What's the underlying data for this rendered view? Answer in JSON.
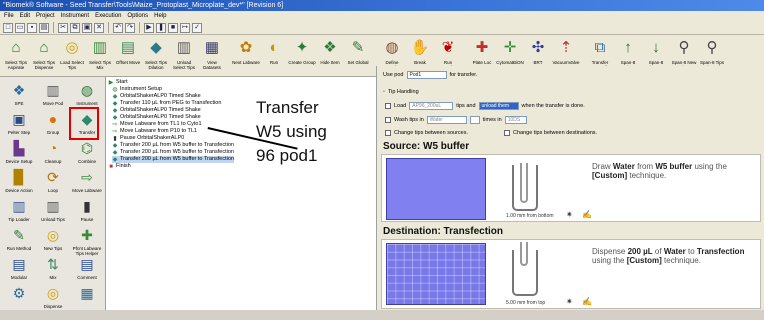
{
  "titlebar": "\"Biomek® Software - Seed Transfer\\Tools\\Maize_Protoplast_Microplate_dev*\" [Revision 6]",
  "menu": [
    "File",
    "Edit",
    "Project",
    "Instrument",
    "Execution",
    "Options",
    "Help"
  ],
  "toolbar": [
    {
      "label": "Select Tips Aspirate",
      "icon": "tip-aspirate-icon",
      "glyph": "⌂",
      "color": "#2a7a3a"
    },
    {
      "label": "Select Tips Dispense",
      "icon": "tip-dispense-icon",
      "glyph": "⌂",
      "color": "#2a7a3a"
    },
    {
      "label": "Load Select Tips",
      "icon": "load-tips-icon",
      "glyph": "◎",
      "color": "#d0a000"
    },
    {
      "label": "Select Tips Mix",
      "icon": "mix-icon",
      "glyph": "▥",
      "color": "#3a8a3a"
    },
    {
      "label": "Offset Move",
      "icon": "offset-move-icon",
      "glyph": "▤",
      "color": "#3a8a5a"
    },
    {
      "label": "Select Tips Dilution",
      "icon": "dilution-icon",
      "glyph": "◆",
      "color": "#2a7a8a"
    },
    {
      "label": "Unload Select Tips",
      "icon": "unload-tips-icon",
      "glyph": "▥",
      "color": "#5a5a5a"
    },
    {
      "label": "View Datasets",
      "icon": "datasets-icon",
      "glyph": "▦",
      "color": "#3a3a6a"
    },
    {
      "label": "Next Labware",
      "icon": "next-labware-icon",
      "glyph": "✿",
      "color": "#c08000"
    },
    {
      "label": "Run",
      "icon": "run-icon",
      "glyph": "◐",
      "color": "#b0a000"
    },
    {
      "label": "Create Group",
      "icon": "create-group-icon",
      "glyph": "✦",
      "color": "#2a7a3a"
    },
    {
      "label": "Hide Item",
      "icon": "hide-item-icon",
      "glyph": "❖",
      "color": "#2a7a3a"
    },
    {
      "label": "Set Global",
      "icon": "set-global-icon",
      "glyph": "✎",
      "color": "#2a7a3a"
    },
    {
      "label": "Define Procedure",
      "icon": "define-procedure-icon",
      "glyph": "◍",
      "color": "#8a4a2a"
    },
    {
      "label": "Break",
      "icon": "break-icon",
      "glyph": "✋",
      "color": "#c03000"
    },
    {
      "label": "Run Procedure",
      "icon": "run-procedure-icon",
      "glyph": "❦",
      "color": "#c00000"
    },
    {
      "label": "Plate Loc",
      "icon": "plate-loc-icon",
      "glyph": "✚",
      "color": "#c03030"
    },
    {
      "label": "CytomatBiON",
      "icon": "cytomat-icon",
      "glyph": "✛",
      "color": "#2a8a3a"
    },
    {
      "label": "BRT",
      "icon": "brt-icon",
      "glyph": "✣",
      "color": "#3a3aa0"
    },
    {
      "label": "VacuumValve",
      "icon": "vacuum-valve-icon",
      "glyph": "⇡",
      "color": "#c03030"
    },
    {
      "label": "Transfer From File",
      "icon": "transfer-file-icon",
      "glyph": "⧉",
      "color": "#2a6a9a"
    },
    {
      "label": "Span-8 Aspirate",
      "icon": "span8-aspirate-icon",
      "glyph": "↑",
      "color": "#2a6a2a"
    },
    {
      "label": "Span-8 Dispense",
      "icon": "span8-dispense-icon",
      "glyph": "↓",
      "color": "#2a6a2a"
    },
    {
      "label": "Span-8 New Tips",
      "icon": "span8-newtips-icon",
      "glyph": "⚲",
      "color": "#444"
    },
    {
      "label": "Span-8 Tips Discard",
      "icon": "span8-discard-icon",
      "glyph": "⚲",
      "color": "#444"
    }
  ],
  "palette": [
    {
      "label": "SPE",
      "icon": "spe-icon",
      "glyph": "❖",
      "color": "#2a6a9a"
    },
    {
      "label": "Move Pod",
      "icon": "move-pod-icon",
      "glyph": "▥",
      "color": "#5a5a5a"
    },
    {
      "label": "Instrument",
      "icon": "instrument-icon",
      "glyph": "◍",
      "color": "#2a7a3a"
    },
    {
      "label": "Pelter Step",
      "icon": "pelter-step-icon",
      "glyph": "▣",
      "color": "#2a4a8a"
    },
    {
      "label": "Group",
      "icon": "group-icon",
      "glyph": "●",
      "color": "#e07000"
    },
    {
      "label": "Transfer",
      "icon": "transfer-icon",
      "glyph": "◆",
      "color": "#2a8a6a"
    },
    {
      "label": "Device Setup",
      "icon": "device-setup-icon",
      "glyph": "▙",
      "color": "#6a3a8a"
    },
    {
      "label": "Cleanup",
      "icon": "cleanup-icon",
      "glyph": "◔",
      "color": "#c08000"
    },
    {
      "label": "Combine",
      "icon": "combine-icon",
      "glyph": "⌬",
      "color": "#3a8a3a"
    },
    {
      "label": "Device Action",
      "icon": "device-action-icon",
      "glyph": "▉",
      "color": "#b08000"
    },
    {
      "label": "Loop",
      "icon": "loop-icon",
      "glyph": "⟳",
      "color": "#c07000"
    },
    {
      "label": "Move Labware",
      "icon": "move-labware-icon",
      "glyph": "⇨",
      "color": "#3a8a3a"
    },
    {
      "label": "Tip Loader",
      "icon": "tip-loader-icon",
      "glyph": "▥",
      "color": "#3a5a9a"
    },
    {
      "label": "Unload Tips",
      "icon": "unload-tips-palette-icon",
      "glyph": "▥",
      "color": "#555"
    },
    {
      "label": "Pause",
      "icon": "pause-icon",
      "glyph": "▮",
      "color": "#333"
    },
    {
      "label": "Run Method",
      "icon": "run-method-icon",
      "glyph": "✎",
      "color": "#2a7a3a"
    },
    {
      "label": "New Tips",
      "icon": "new-tips-icon",
      "glyph": "◎",
      "color": "#d0a000"
    },
    {
      "label": "Pfcnt Labware Tips Helper",
      "icon": "labware-helper-icon",
      "glyph": "✚",
      "color": "#3a8a3a"
    },
    {
      "label": "Modular",
      "icon": "modular-icon",
      "glyph": "▤",
      "color": "#2a4a8a"
    },
    {
      "label": "Mix",
      "icon": "mix-palette-icon",
      "glyph": "⇅",
      "color": "#3a8a6a"
    },
    {
      "label": "Comment",
      "icon": "comment-icon",
      "glyph": "▤",
      "color": "#2a4a9a"
    },
    {
      "label": "",
      "icon": "plugin-icon",
      "glyph": "⚙",
      "color": "#2a6a9a"
    },
    {
      "label": "Dispense",
      "icon": "dispense-icon",
      "glyph": "◎",
      "color": "#d0a000"
    },
    {
      "label": "",
      "icon": "extra-icon",
      "glyph": "▦",
      "color": "#2a6a9a"
    }
  ],
  "protocol_steps": [
    {
      "text": "Start",
      "icon": "start-icon",
      "glyph": "▶",
      "color": "#2a8a2a"
    },
    {
      "text": "Instrument Setup",
      "icon": "instrument-setup-icon",
      "glyph": "◍",
      "color": "#2a7a3a"
    },
    {
      "text": "OrbitalShakerALP0 Timed Shake",
      "icon": "shake-icon",
      "glyph": "◆",
      "color": "#3a8a6a"
    },
    {
      "text": "Transfer 110 µL from PEG to Transfection",
      "icon": "transfer-step-icon",
      "glyph": "◆",
      "color": "#2a8a6a"
    },
    {
      "text": "OrbitalShakerALP0 Timed Shake",
      "icon": "shake-icon",
      "glyph": "◆",
      "color": "#3a8a6a"
    },
    {
      "text": "OrbitalShakerALP0 Timed Shake",
      "icon": "shake-icon",
      "glyph": "◆",
      "color": "#3a8a6a"
    },
    {
      "text": "Move Labware from TL1 to Cyto1",
      "icon": "move-labware-step-icon",
      "glyph": "⇨",
      "color": "#3a8a3a"
    },
    {
      "text": "Move Labware from P10 to TL1",
      "icon": "move-labware-step-icon",
      "glyph": "⇨",
      "color": "#3a8a3a"
    },
    {
      "text": "Pause OrbitalShakerALP0",
      "icon": "pause-step-icon",
      "glyph": "▮",
      "color": "#333"
    },
    {
      "text": "Transfer 200 µL from W5 buffer to Transfection",
      "icon": "transfer-step-icon",
      "glyph": "◆",
      "color": "#2a8a6a"
    },
    {
      "text": "Transfer 200 µL from W5 buffer to Transfection",
      "icon": "transfer-step-icon",
      "glyph": "◆",
      "color": "#2a8a6a"
    },
    {
      "text": "Transfer 200 µL from W5 buffer to Transfection",
      "icon": "transfer-step-icon",
      "glyph": "◆",
      "color": "#2a8a6a"
    },
    {
      "text": "Finish",
      "icon": "finish-icon",
      "glyph": "■",
      "color": "#c03030"
    }
  ],
  "selected_step_index": 11,
  "annotation": [
    "Transfer",
    "W5 using",
    "96 pod1"
  ],
  "props": {
    "use_pod_label": "Use pod",
    "use_pod_value": "Pod1",
    "use_pod_suffix": "for transfer.",
    "tip_handling": "Tip Handling",
    "load_label": "Load",
    "load_value": "AP96_200uL",
    "tips_and": "tips and",
    "unload_value": "unload them",
    "when_done": "when the transfer is done.",
    "wash_label": "Wash tips in",
    "wash_value": "Water",
    "wash_times": "times in",
    "wash_tips": "10DS",
    "change_sources": "Change tips between sources.",
    "change_dest": "Change tips between destinations.",
    "source_title": "Source: W5 buffer",
    "source_desc_1": "Draw",
    "source_desc_liquid": "Water",
    "source_desc_2": "from",
    "source_desc_src": "W5 buffer",
    "source_desc_3": "using the",
    "source_desc_tech": "[Custom]",
    "source_desc_4": "technique.",
    "source_height": "1.00 mm from bottom",
    "dest_title": "Destination: Transfection",
    "dest_desc_1": "Dispense",
    "dest_desc_vol": "200 µL",
    "dest_desc_2": "of",
    "dest_desc_liquid": "Water",
    "dest_desc_3": "to",
    "dest_desc_dst": "Transfection",
    "dest_desc_4": "using the",
    "dest_desc_tech": "[Custom]",
    "dest_desc_5": "technique.",
    "dest_height": "5.00 mm from top"
  },
  "colors": {
    "plate_source": "#8080f0",
    "plate_dest": "#7878e8",
    "selection": "#c0d6f0",
    "highlight": "#e00000"
  }
}
